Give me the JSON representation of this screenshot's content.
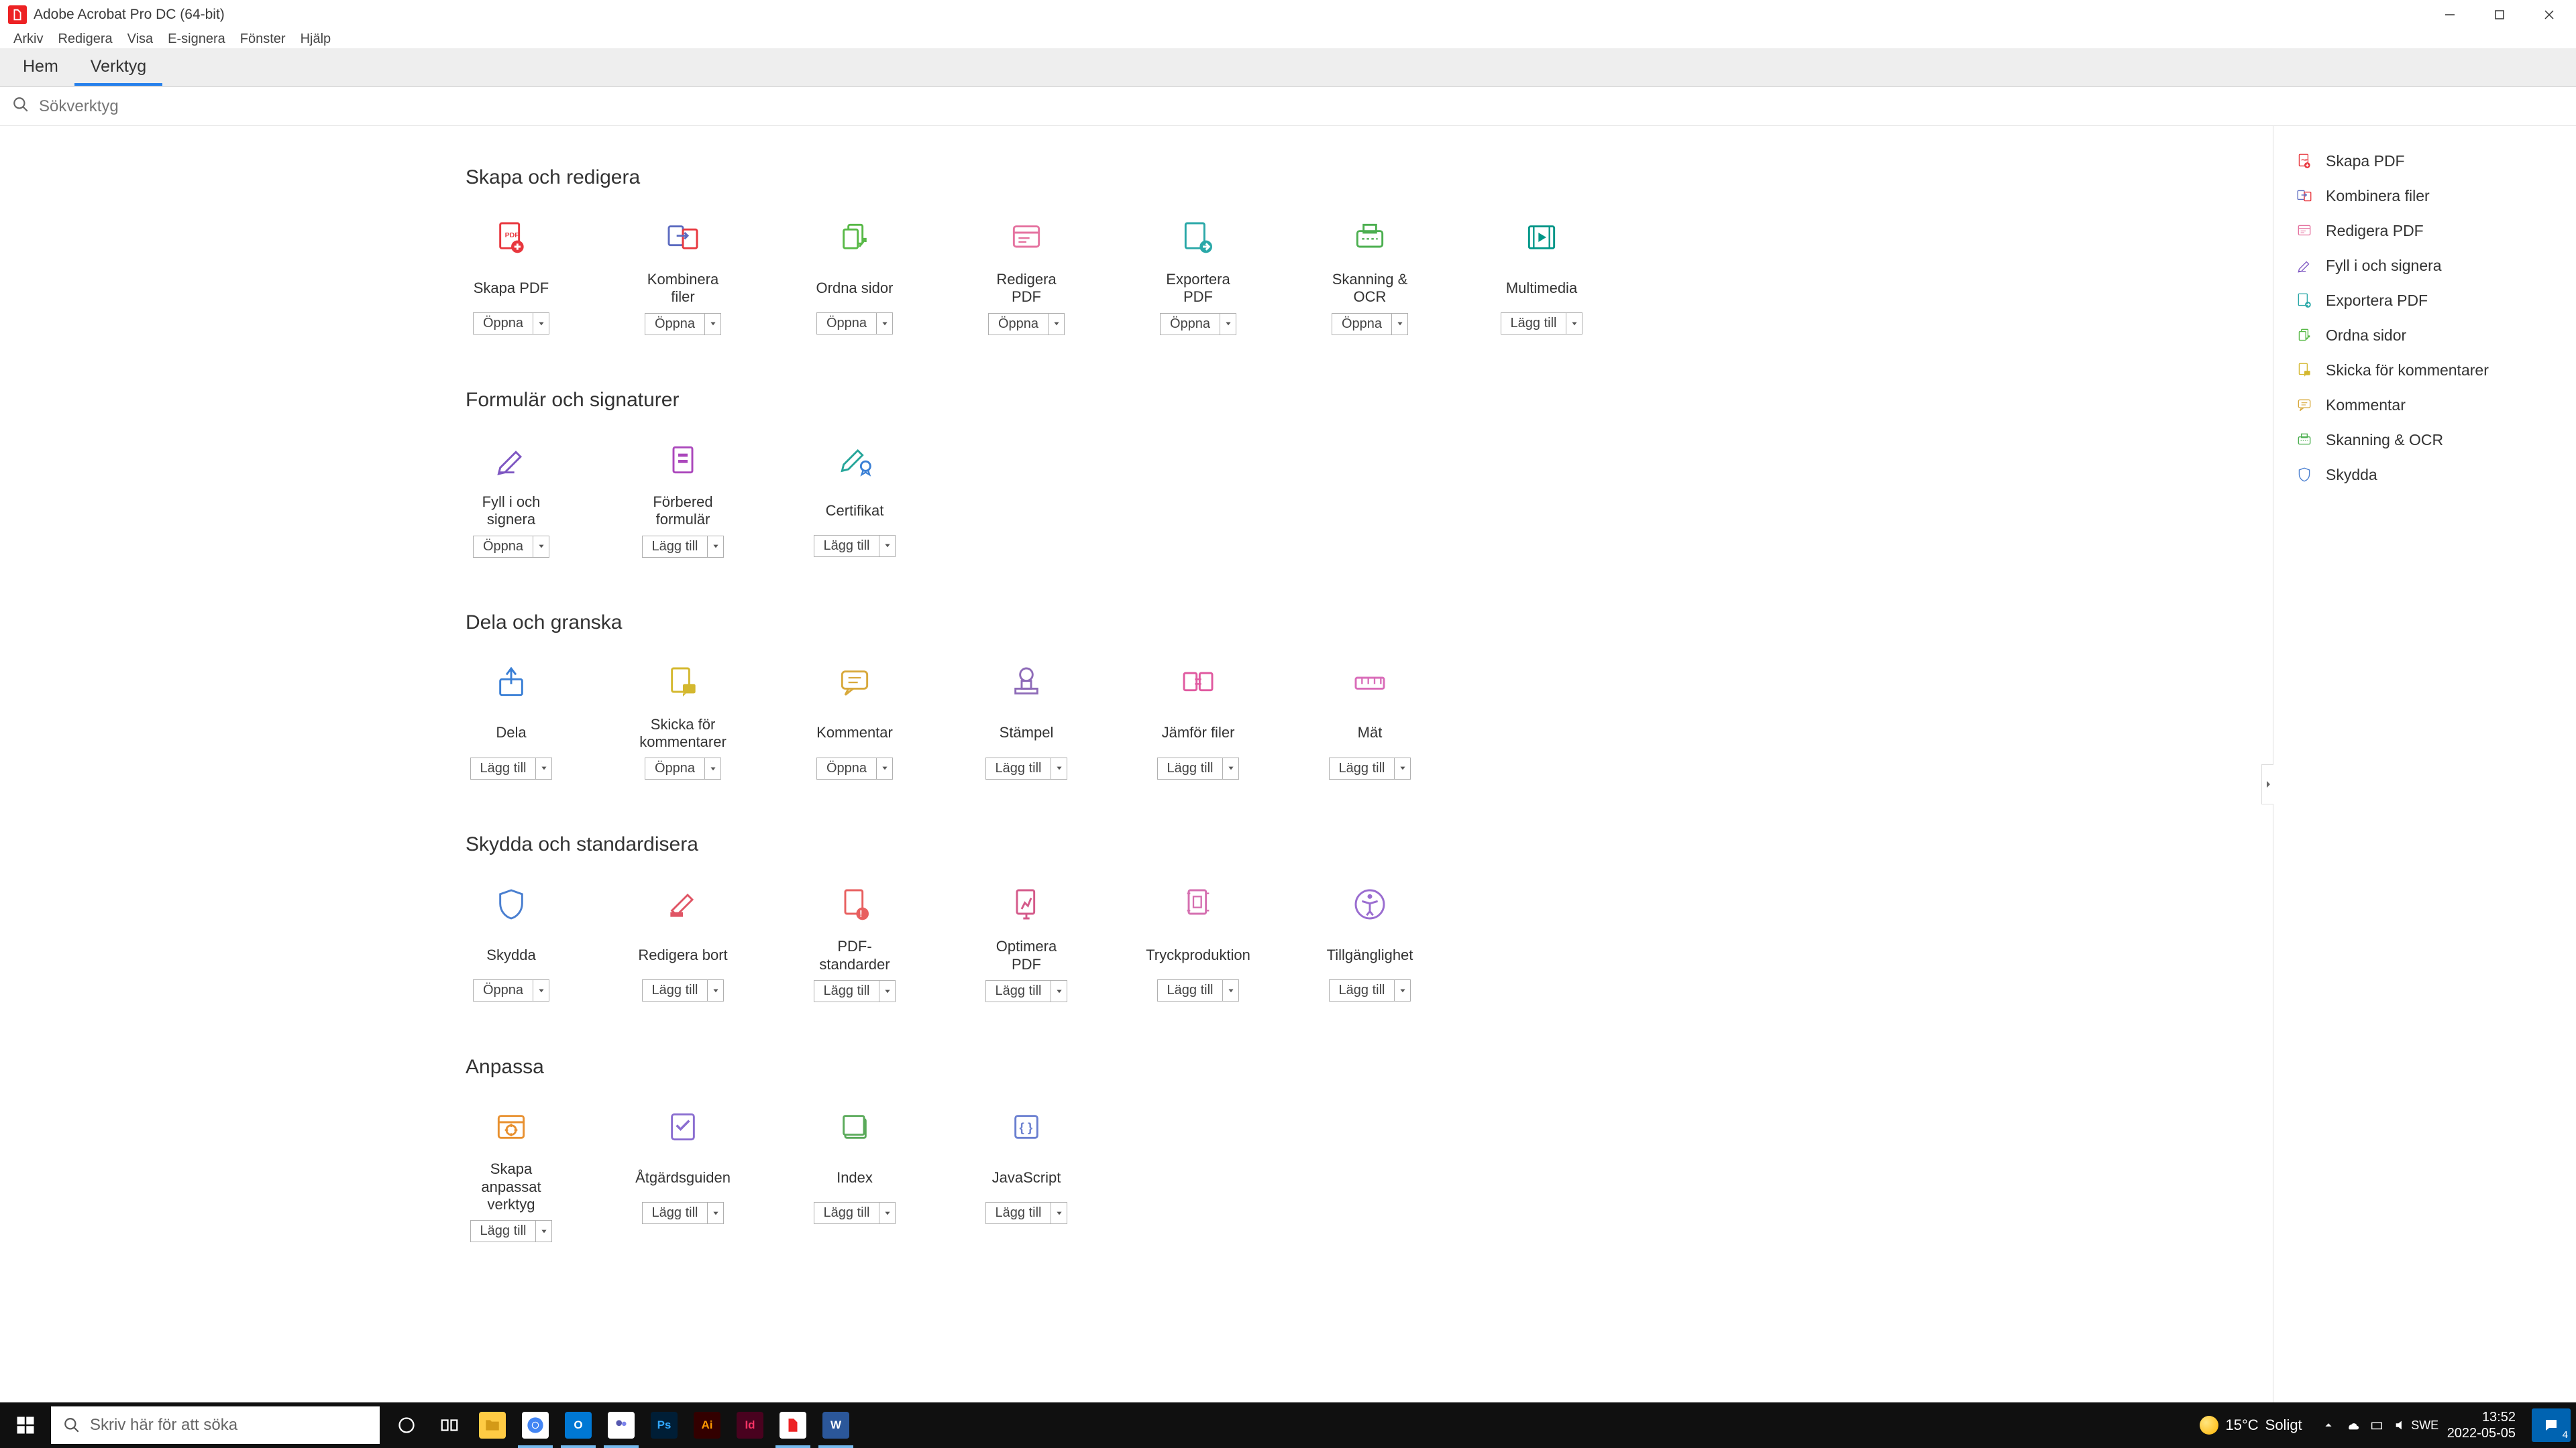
{
  "app": {
    "title": "Adobe Acrobat Pro DC (64-bit)"
  },
  "menu": [
    "Arkiv",
    "Redigera",
    "Visa",
    "E-signera",
    "Fönster",
    "Hjälp"
  ],
  "tabs": {
    "home": "Hem",
    "tools": "Verktyg"
  },
  "search": {
    "placeholder": "Sökverktyg"
  },
  "buttons": {
    "open": "Öppna",
    "add": "Lägg till"
  },
  "sections": [
    {
      "title": "Skapa och redigera",
      "tools": [
        {
          "name": "Skapa PDF",
          "btn": "open",
          "icon": "create-pdf",
          "color": "#e8373e"
        },
        {
          "name": "Kombinera filer",
          "btn": "open",
          "icon": "combine",
          "color": "#5c6bc0"
        },
        {
          "name": "Ordna sidor",
          "btn": "open",
          "icon": "organize",
          "color": "#58b947"
        },
        {
          "name": "Redigera PDF",
          "btn": "open",
          "icon": "edit-pdf",
          "color": "#e573a0"
        },
        {
          "name": "Exportera PDF",
          "btn": "open",
          "icon": "export-pdf",
          "color": "#2aa8a8"
        },
        {
          "name": "Skanning & OCR",
          "btn": "open",
          "icon": "scan",
          "color": "#4caf50"
        },
        {
          "name": "Multimedia",
          "btn": "add",
          "icon": "multimedia",
          "color": "#009688"
        }
      ]
    },
    {
      "title": "Formulär och signaturer",
      "tools": [
        {
          "name": "Fyll i och signera",
          "btn": "open",
          "icon": "fill-sign",
          "color": "#7e57c2"
        },
        {
          "name": "Förbered formulär",
          "btn": "add",
          "icon": "prepare-form",
          "color": "#ab47bc"
        },
        {
          "name": "Certifikat",
          "btn": "add",
          "icon": "certificate",
          "color": "#26a69a"
        }
      ]
    },
    {
      "title": "Dela och granska",
      "tools": [
        {
          "name": "Dela",
          "btn": "add",
          "icon": "share",
          "color": "#3a7fd5"
        },
        {
          "name": "Skicka för kommentarer",
          "btn": "open",
          "icon": "send-comments",
          "color": "#d4b82f"
        },
        {
          "name": "Kommentar",
          "btn": "open",
          "icon": "comment",
          "color": "#d8a93c"
        },
        {
          "name": "Stämpel",
          "btn": "add",
          "icon": "stamp",
          "color": "#8e6bb8"
        },
        {
          "name": "Jämför filer",
          "btn": "add",
          "icon": "compare",
          "color": "#e05aa0"
        },
        {
          "name": "Mät",
          "btn": "add",
          "icon": "measure",
          "color": "#d96cb9"
        }
      ]
    },
    {
      "title": "Skydda och standardisera",
      "tools": [
        {
          "name": "Skydda",
          "btn": "open",
          "icon": "protect",
          "color": "#4a7fd0"
        },
        {
          "name": "Redigera bort",
          "btn": "add",
          "icon": "redact",
          "color": "#e05565"
        },
        {
          "name": "PDF-standarder",
          "btn": "add",
          "icon": "standards",
          "color": "#e86060"
        },
        {
          "name": "Optimera PDF",
          "btn": "add",
          "icon": "optimize",
          "color": "#d45a8a"
        },
        {
          "name": "Tryckproduktion",
          "btn": "add",
          "icon": "print-prod",
          "color": "#d56fb0"
        },
        {
          "name": "Tillgänglighet",
          "btn": "add",
          "icon": "accessibility",
          "color": "#9a6dd0"
        }
      ]
    },
    {
      "title": "Anpassa",
      "tools": [
        {
          "name": "Skapa anpassat verktyg",
          "btn": "add",
          "icon": "custom-tool",
          "color": "#e8902f"
        },
        {
          "name": "Åtgärdsguiden",
          "btn": "add",
          "icon": "action-wizard",
          "color": "#8a6dd0"
        },
        {
          "name": "Index",
          "btn": "add",
          "icon": "index",
          "color": "#5aaa5a"
        },
        {
          "name": "JavaScript",
          "btn": "add",
          "icon": "javascript",
          "color": "#6a7fd0"
        }
      ]
    }
  ],
  "rightPanel": [
    {
      "label": "Skapa PDF",
      "icon": "create-pdf",
      "color": "#e8373e"
    },
    {
      "label": "Kombinera filer",
      "icon": "combine",
      "color": "#5c6bc0"
    },
    {
      "label": "Redigera PDF",
      "icon": "edit-pdf",
      "color": "#e573a0"
    },
    {
      "label": "Fyll i och signera",
      "icon": "fill-sign",
      "color": "#7e57c2"
    },
    {
      "label": "Exportera PDF",
      "icon": "export-pdf",
      "color": "#2aa8a8"
    },
    {
      "label": "Ordna sidor",
      "icon": "organize",
      "color": "#58b947"
    },
    {
      "label": "Skicka för kommentarer",
      "icon": "send-comments",
      "color": "#d4b82f"
    },
    {
      "label": "Kommentar",
      "icon": "comment",
      "color": "#d8a93c"
    },
    {
      "label": "Skanning & OCR",
      "icon": "scan",
      "color": "#4caf50"
    },
    {
      "label": "Skydda",
      "icon": "protect",
      "color": "#4a7fd0"
    }
  ],
  "taskbar": {
    "search": "Skriv här för att söka",
    "weather": {
      "temp": "15°C",
      "cond": "Soligt"
    },
    "time": "13:52",
    "date": "2022-05-05",
    "notif": "4"
  }
}
